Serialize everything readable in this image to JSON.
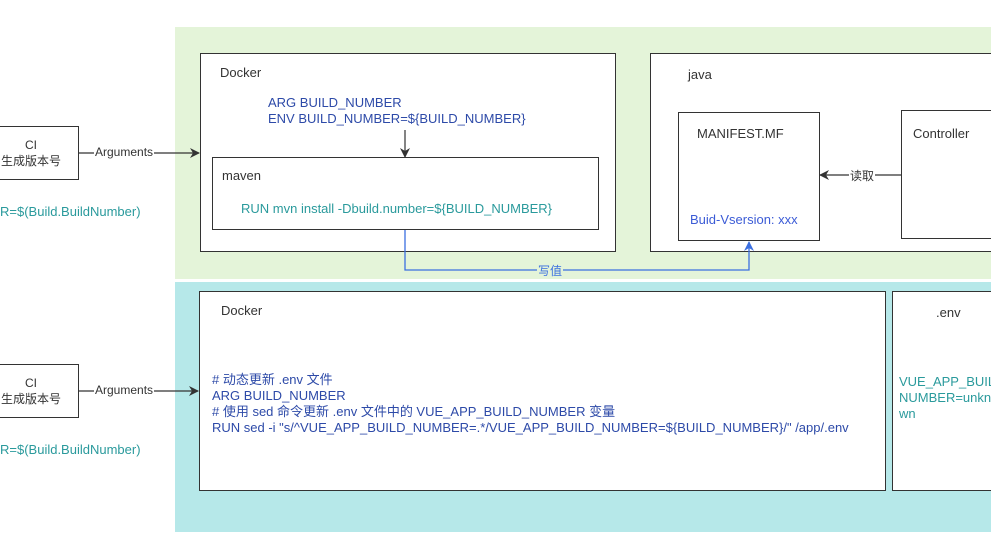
{
  "top": {
    "ci": {
      "line1": "CI",
      "line2": "生成版本号",
      "var": "R=$(Build.BuildNumber)"
    },
    "arrow_label": "Arguments",
    "docker": {
      "title": "Docker",
      "code_lines": [
        "ARG BUILD_NUMBER",
        "ENV BUILD_NUMBER=${BUILD_NUMBER}"
      ]
    },
    "maven": {
      "title": "maven",
      "command": "RUN mvn install -Dbuild.number=${BUILD_NUMBER}"
    },
    "java": {
      "title": "java"
    },
    "manifest": {
      "title": "MANIFEST.MF",
      "value": "Buid-Vsersion: xxx"
    },
    "controller": {
      "title": "Controller"
    },
    "read_label": "读取",
    "write_label": "写值"
  },
  "bottom": {
    "ci": {
      "line1": "CI",
      "line2": "生成版本号",
      "var": "R=$(Build.BuildNumber)"
    },
    "arrow_label": "Arguments",
    "docker": {
      "title": "Docker",
      "code_lines": [
        "# 动态更新 .env 文件",
        "ARG BUILD_NUMBER",
        "# 使用 sed 命令更新 .env 文件中的 VUE_APP_BUILD_NUMBER 变量",
        "RUN sed -i \"s/^VUE_APP_BUILD_NUMBER=.*/VUE_APP_BUILD_NUMBER=${BUILD_NUMBER}/\" /app/.env"
      ]
    },
    "env": {
      "title": ".env",
      "lines": [
        "VUE_APP_BUIL",
        "NUMBER=unkn",
        "wn"
      ]
    }
  },
  "colors": {
    "green_region": "#e4f4d9",
    "cyan_region": "#b6e8e9",
    "teal_text": "#2a9a9c",
    "blue_text": "#3b5bd6",
    "navy_text": "#2d4aa8",
    "write_arrow": "#3b6fe0"
  }
}
